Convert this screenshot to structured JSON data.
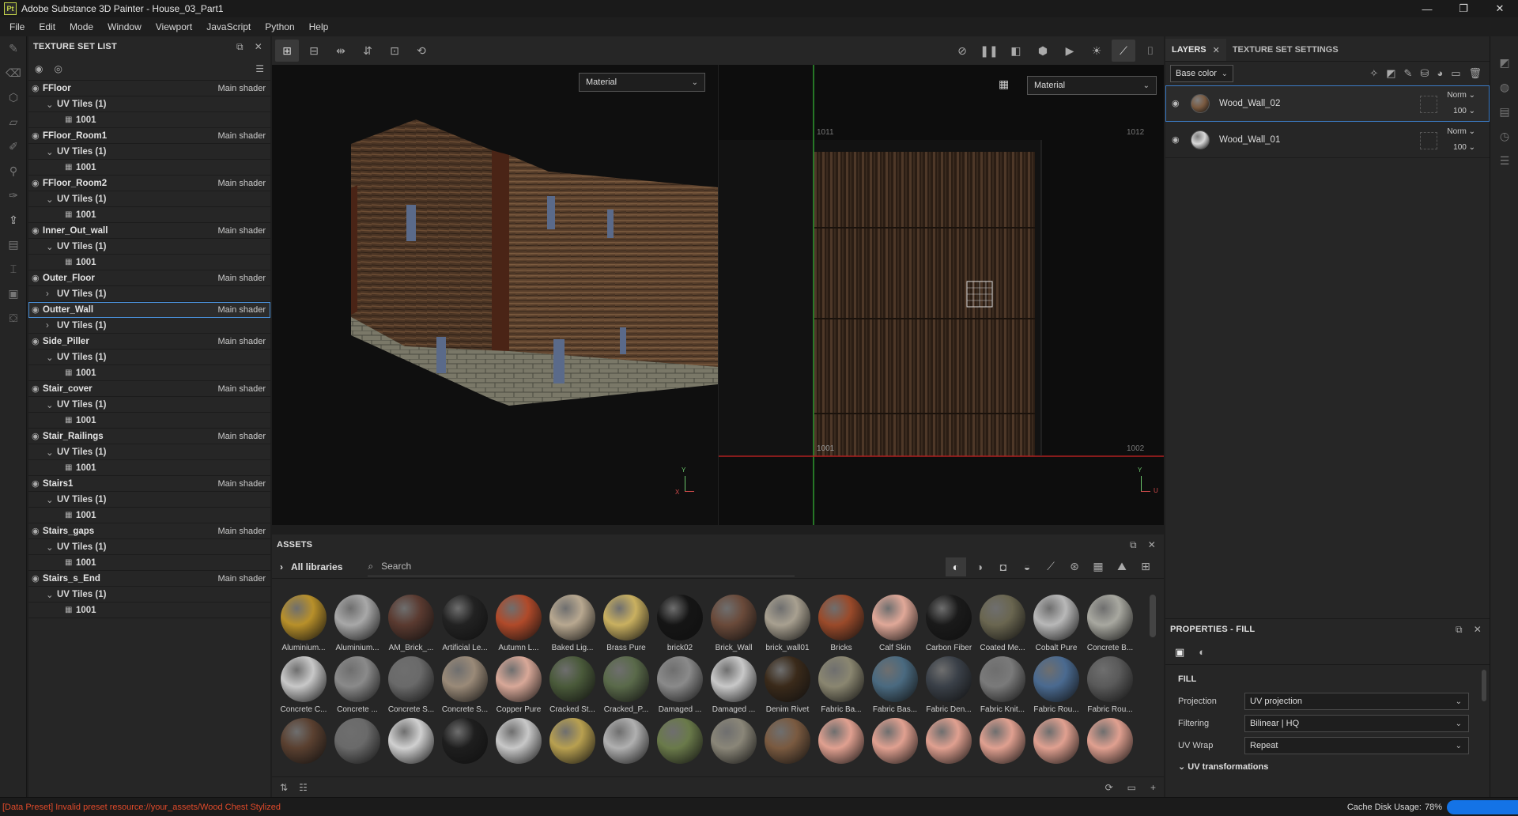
{
  "window": {
    "app_icon": "Pt",
    "title": "Adobe Substance 3D Painter - House_03_Part1",
    "minimize": "—",
    "maximize": "❐",
    "close": "✕"
  },
  "menu": [
    "File",
    "Edit",
    "Mode",
    "Window",
    "Viewport",
    "JavaScript",
    "Python",
    "Help"
  ],
  "texture_set_list": {
    "title": "TEXTURE SET LIST",
    "sets": [
      {
        "name": "FFloor",
        "shader": "Main shader",
        "uv": "UV Tiles (1)",
        "expanded": true,
        "tile": "1001"
      },
      {
        "name": "FFloor_Room1",
        "shader": "Main shader",
        "uv": "UV Tiles (1)",
        "expanded": true,
        "tile": "1001"
      },
      {
        "name": "FFloor_Room2",
        "shader": "Main shader",
        "uv": "UV Tiles (1)",
        "expanded": true,
        "tile": "1001"
      },
      {
        "name": "Inner_Out_wall",
        "shader": "Main shader",
        "uv": "UV Tiles (1)",
        "expanded": true,
        "tile": "1001"
      },
      {
        "name": "Outer_Floor",
        "shader": "Main shader",
        "uv": "UV Tiles (1)",
        "expanded": false,
        "tile": ""
      },
      {
        "name": "Outter_Wall",
        "shader": "Main shader",
        "uv": "UV Tiles (1)",
        "expanded": false,
        "tile": "",
        "selected": true
      },
      {
        "name": "Side_Piller",
        "shader": "Main shader",
        "uv": "UV Tiles (1)",
        "expanded": true,
        "tile": "1001"
      },
      {
        "name": "Stair_cover",
        "shader": "Main shader",
        "uv": "UV Tiles (1)",
        "expanded": true,
        "tile": "1001"
      },
      {
        "name": "Stair_Railings",
        "shader": "Main shader",
        "uv": "UV Tiles (1)",
        "expanded": true,
        "tile": "1001"
      },
      {
        "name": "Stairs1",
        "shader": "Main shader",
        "uv": "UV Tiles (1)",
        "expanded": true,
        "tile": "1001"
      },
      {
        "name": "Stairs_gaps",
        "shader": "Main shader",
        "uv": "UV Tiles (1)",
        "expanded": true,
        "tile": "1001"
      },
      {
        "name": "Stairs_s_End",
        "shader": "Main shader",
        "uv": "UV Tiles (1)",
        "expanded": true,
        "tile": "1001"
      }
    ]
  },
  "viewport": {
    "left_mode": "Material",
    "right_mode": "Material",
    "uv_labels": {
      "top_left": "1011",
      "top_right": "1012",
      "bottom_left": "1001",
      "bottom_right": "1002"
    },
    "axis_y": "Y",
    "axis_x": "X",
    "axis_u": "U"
  },
  "assets": {
    "title": "ASSETS",
    "library": "All libraries",
    "search_placeholder": "Search",
    "items": [
      {
        "label": "Aluminium...",
        "color": "#b8902a"
      },
      {
        "label": "Aluminium...",
        "color": "#a8a8a8"
      },
      {
        "label": "AM_Brick_...",
        "color": "#5a3a30"
      },
      {
        "label": "Artificial Le...",
        "color": "#222222"
      },
      {
        "label": "Autumn L...",
        "color": "#b04a2a"
      },
      {
        "label": "Baked Lig...",
        "color": "#b8a890"
      },
      {
        "label": "Brass Pure",
        "color": "#c9b060"
      },
      {
        "label": "brick02",
        "color": "#151515"
      },
      {
        "label": "Brick_Wall",
        "color": "#6a4a3a"
      },
      {
        "label": "brick_wall01",
        "color": "#a8a090"
      },
      {
        "label": "Bricks",
        "color": "#9a4a2a"
      },
      {
        "label": "Calf Skin",
        "color": "#e0a898"
      },
      {
        "label": "Carbon Fiber",
        "color": "#1a1a1a"
      },
      {
        "label": "Coated Me...",
        "color": "#6a6650"
      },
      {
        "label": "Cobalt Pure",
        "color": "#b8b8b8"
      },
      {
        "label": "Concrete B...",
        "color": "#a8a8a0"
      },
      {
        "label": "Concrete C...",
        "color": "#c8c8c8"
      },
      {
        "label": "Concrete ...",
        "color": "#8a8a8a"
      },
      {
        "label": "Concrete S...",
        "color": "#6a6a6a"
      },
      {
        "label": "Concrete S...",
        "color": "#9a8a78"
      },
      {
        "label": "Copper Pure",
        "color": "#d8a898"
      },
      {
        "label": "Cracked St...",
        "color": "#4a5a3a"
      },
      {
        "label": "Cracked_P...",
        "color": "#5a6a4a"
      },
      {
        "label": "Damaged ...",
        "color": "#8a8a8a"
      },
      {
        "label": "Damaged ...",
        "color": "#c8c8c8"
      },
      {
        "label": "Denim Rivet",
        "color": "#3a2a1a"
      },
      {
        "label": "Fabric Ba...",
        "color": "#8a8670"
      },
      {
        "label": "Fabric Bas...",
        "color": "#4a6a80"
      },
      {
        "label": "Fabric Den...",
        "color": "#3a4048"
      },
      {
        "label": "Fabric Knit...",
        "color": "#7a7a7a"
      },
      {
        "label": "Fabric Rou...",
        "color": "#4a6a90"
      },
      {
        "label": "Fabric Rou...",
        "color": "#5a5a5a"
      },
      {
        "label": "",
        "color": "#5a4030"
      },
      {
        "label": "",
        "color": "#6a6a6a"
      },
      {
        "label": "",
        "color": "#d0d0d0"
      },
      {
        "label": "",
        "color": "#1e1e1e"
      },
      {
        "label": "",
        "color": "#c8c8c8"
      },
      {
        "label": "",
        "color": "#b8a050"
      },
      {
        "label": "",
        "color": "#b0b0b0"
      },
      {
        "label": "",
        "color": "#6a7a4a"
      },
      {
        "label": "",
        "color": "#8a8678"
      },
      {
        "label": "",
        "color": "#7a5a40"
      },
      {
        "label": "",
        "color": "#e0a090"
      },
      {
        "label": "",
        "color": "#e0a090"
      },
      {
        "label": "",
        "color": "#e0a090"
      },
      {
        "label": "",
        "color": "#e0a090"
      },
      {
        "label": "",
        "color": "#e0a090"
      },
      {
        "label": "",
        "color": "#e0a090"
      }
    ]
  },
  "layers": {
    "tab_layers": "LAYERS",
    "tab_tss": "TEXTURE SET SETTINGS",
    "channel": "Base color",
    "items": [
      {
        "name": "Wood_Wall_02",
        "blend": "Norm",
        "opacity": "100",
        "thumb": "#7a5a40",
        "selected": true
      },
      {
        "name": "Wood_Wall_01",
        "blend": "Norm",
        "opacity": "100",
        "thumb": "#d8d8d8",
        "selected": false
      }
    ]
  },
  "properties": {
    "title": "PROPERTIES - FILL",
    "section": "FILL",
    "rows": [
      {
        "label": "Projection",
        "value": "UV projection"
      },
      {
        "label": "Filtering",
        "value": "Bilinear | HQ"
      },
      {
        "label": "UV Wrap",
        "value": "Repeat"
      }
    ],
    "uv_transformations": "UV transformations"
  },
  "status": {
    "message": "[Data Preset] Invalid preset resource://your_assets/Wood Chest Stylized",
    "cache_label": "Cache Disk Usage:",
    "cache_value": "78%"
  },
  "colors": {
    "accent": "#4a90d9",
    "error": "#e04a2a",
    "cache_bar": "#1473e6"
  }
}
